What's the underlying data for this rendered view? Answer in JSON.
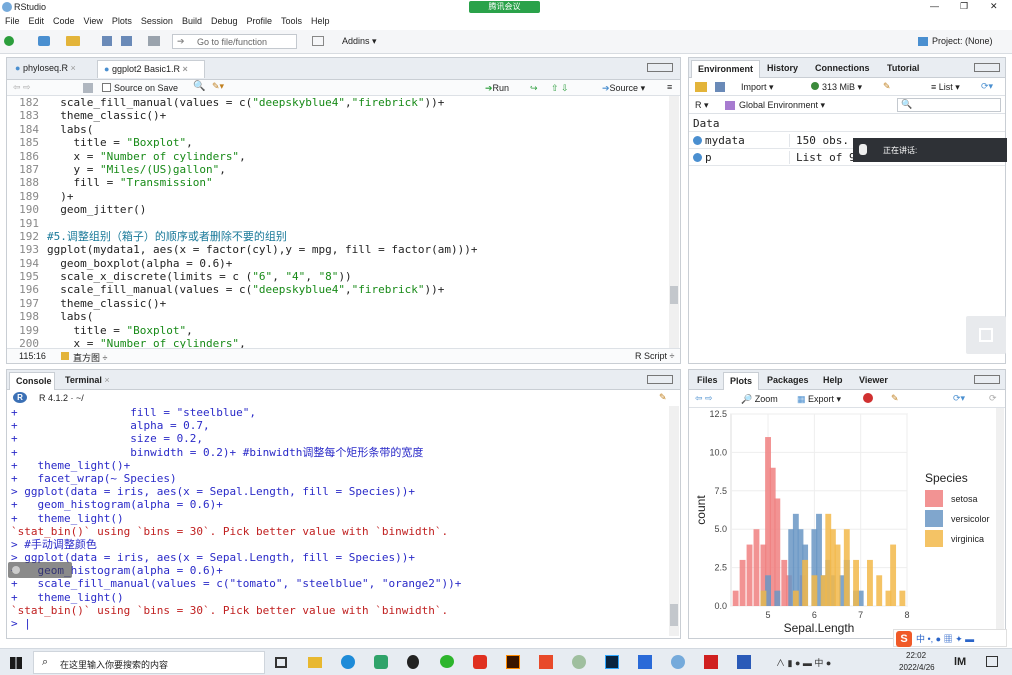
{
  "window": {
    "title": "RStudio",
    "meeting_badge": "腾讯会议",
    "min": "—",
    "restore": "❐",
    "close": "✕"
  },
  "menu": [
    "File",
    "Edit",
    "Code",
    "View",
    "Plots",
    "Session",
    "Build",
    "Debug",
    "Profile",
    "Tools",
    "Help"
  ],
  "toolbar": {
    "goto": "Go to file/function",
    "addins": "Addins",
    "project": "Project: (None)"
  },
  "editor": {
    "tabs": [
      "phyloseq.R",
      "ggplot2 Basic1.R"
    ],
    "source_on_save": "Source on Save",
    "run": "Run",
    "source": "Source",
    "lines": [
      {
        "n": "182",
        "t": "  scale_fill_manual(values = c(\"deepskyblue4\",\"firebrick\"))+"
      },
      {
        "n": "183",
        "t": "  theme_classic()+"
      },
      {
        "n": "184",
        "t": "  labs("
      },
      {
        "n": "185",
        "t": "    title = \"Boxplot\","
      },
      {
        "n": "186",
        "t": "    x = \"Number of cylinders\","
      },
      {
        "n": "187",
        "t": "    y = \"Miles/(US)gallon\","
      },
      {
        "n": "188",
        "t": "    fill = \"Transmission\""
      },
      {
        "n": "189",
        "t": "  )+"
      },
      {
        "n": "190",
        "t": "  geom_jitter()"
      },
      {
        "n": "191",
        "t": ""
      },
      {
        "n": "192",
        "t": "#5.调整组别（箱子）的顺序或者删除不要的组别"
      },
      {
        "n": "193",
        "t": "ggplot(mydata1, aes(x = factor(cyl),y = mpg, fill = factor(am)))+"
      },
      {
        "n": "194",
        "t": "  geom_boxplot(alpha = 0.6)+"
      },
      {
        "n": "195",
        "t": "  scale_x_discrete(limits = c (\"6\", \"4\", \"8\"))"
      },
      {
        "n": "196",
        "t": "  scale_fill_manual(values = c(\"deepskyblue4\",\"firebrick\"))+"
      },
      {
        "n": "197",
        "t": "  theme_classic()+"
      },
      {
        "n": "198",
        "t": "  labs("
      },
      {
        "n": "199",
        "t": "    title = \"Boxplot\","
      },
      {
        "n": "200",
        "t": "    x = \"Number of cylinders\","
      }
    ],
    "status_pos": "115:16",
    "status_section": "直方图 ÷",
    "status_type": "R Script ÷"
  },
  "console": {
    "tabs": [
      "Console",
      "Terminal"
    ],
    "version": "R 4.1.2 · ~/",
    "lines": [
      {
        "c": "blue",
        "t": "+                 fill = \"steelblue\","
      },
      {
        "c": "blue",
        "t": "+                 alpha = 0.7,"
      },
      {
        "c": "blue",
        "t": "+                 size = 0.2,"
      },
      {
        "c": "blue",
        "t": "+                 binwidth = 0.2)+ #binwidth调整每个矩形条带的宽度"
      },
      {
        "c": "blue",
        "t": "+   theme_light()+"
      },
      {
        "c": "blue",
        "t": "+   facet_wrap(~ Species)"
      },
      {
        "c": "blue",
        "t": "> ggplot(data = iris, aes(x = Sepal.Length, fill = Species))+"
      },
      {
        "c": "blue",
        "t": "+   geom_histogram(alpha = 0.6)+"
      },
      {
        "c": "blue",
        "t": "+   theme_light()"
      },
      {
        "c": "red",
        "t": "`stat_bin()` using `bins = 30`. Pick better value with `binwidth`."
      },
      {
        "c": "blue",
        "t": "> #手动调整颜色"
      },
      {
        "c": "blue",
        "t": "> ggplot(data = iris, aes(x = Sepal.Length, fill = Species))+"
      },
      {
        "c": "blue",
        "t": "+   geom_histogram(alpha = 0.6)+"
      },
      {
        "c": "blue",
        "t": "+   scale_fill_manual(values = c(\"tomato\", \"steelblue\", \"orange2\"))+"
      },
      {
        "c": "blue",
        "t": "+   theme_light()"
      },
      {
        "c": "red",
        "t": "`stat_bin()` using `bins = 30`. Pick better value with `binwidth`."
      },
      {
        "c": "blue",
        "t": "> |"
      }
    ]
  },
  "env": {
    "tabs": [
      "Environment",
      "History",
      "Connections",
      "Tutorial"
    ],
    "import": "Import",
    "mem": "313 MiB",
    "list": "List",
    "r": "R",
    "global": "Global Environment",
    "section": "Data",
    "rows": [
      {
        "name": "mydata",
        "value": "150 obs. o"
      },
      {
        "name": "p",
        "value": "List of  9"
      }
    ],
    "speaking": "正在讲话:"
  },
  "files": {
    "tabs": [
      "Files",
      "Plots",
      "Packages",
      "Help",
      "Viewer"
    ],
    "zoom": "Zoom",
    "export": "Export"
  },
  "chart_data": {
    "type": "bar",
    "title": "",
    "xlabel": "Sepal.Length",
    "ylabel": "count",
    "ylim": [
      0,
      12.5
    ],
    "xlim": [
      4.2,
      8.0
    ],
    "yticks": [
      "0.0",
      "2.5",
      "5.0",
      "7.5",
      "10.0",
      "12.5"
    ],
    "xticks": [
      "5",
      "6",
      "7",
      "8"
    ],
    "legend_title": "Species",
    "series": [
      {
        "name": "setosa",
        "color": "#F08080",
        "x": [
          4.3,
          4.45,
          4.6,
          4.75,
          4.9,
          5.0,
          5.1,
          5.2,
          5.35,
          5.45,
          5.6,
          5.75
        ],
        "values": [
          1,
          3,
          4,
          5,
          4,
          11,
          9,
          7,
          3,
          2,
          1,
          2
        ]
      },
      {
        "name": "versicolor",
        "color": "#6A97C4",
        "x": [
          4.9,
          5.0,
          5.2,
          5.5,
          5.6,
          5.7,
          5.8,
          6.0,
          6.1,
          6.2,
          6.3,
          6.4,
          6.6,
          6.7,
          6.9,
          7.0
        ],
        "values": [
          1,
          2,
          1,
          5,
          6,
          5,
          4,
          5,
          6,
          2,
          3,
          2,
          2,
          3,
          1,
          1
        ]
      },
      {
        "name": "virginica",
        "color": "#F2B94A",
        "x": [
          4.9,
          5.6,
          5.8,
          6.0,
          6.2,
          6.3,
          6.4,
          6.5,
          6.7,
          6.9,
          7.2,
          7.4,
          7.6,
          7.7,
          7.9
        ],
        "values": [
          1,
          1,
          3,
          2,
          2,
          6,
          5,
          4,
          5,
          3,
          3,
          2,
          1,
          4,
          1
        ]
      }
    ]
  },
  "taskbar": {
    "search": "在这里输入你要搜索的内容",
    "time": "22:02",
    "date": "2022/4/26"
  }
}
